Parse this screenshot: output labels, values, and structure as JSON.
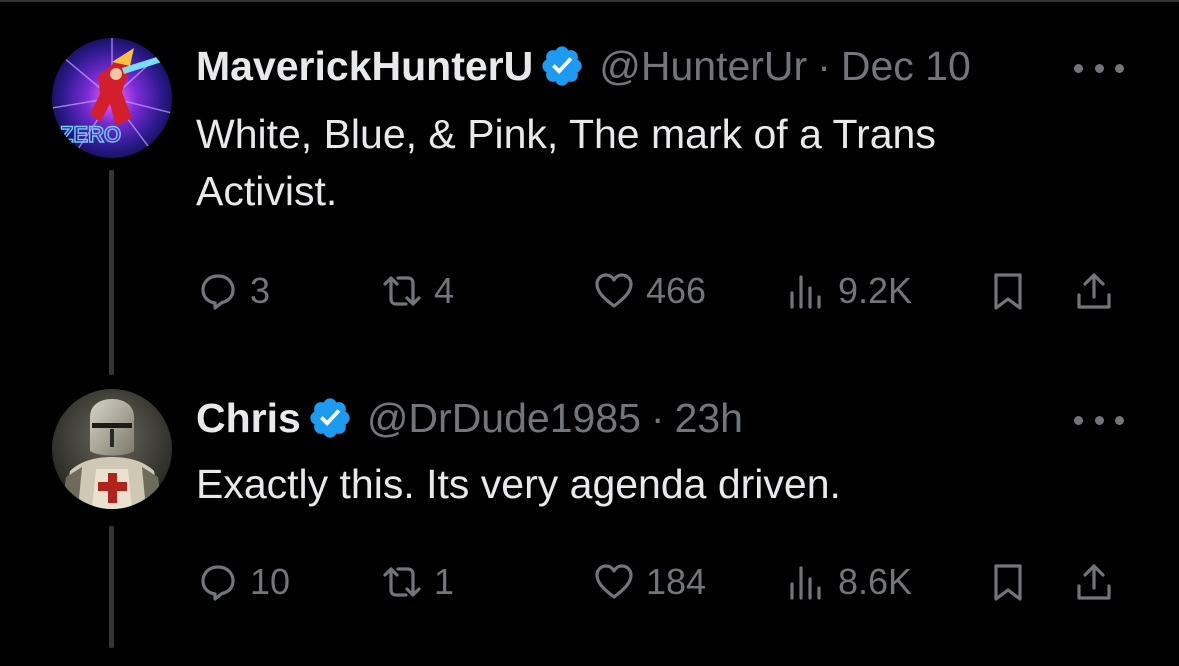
{
  "tweets": [
    {
      "display_name": "MaverickHunterU",
      "handle": "@HunterUr",
      "separator": "·",
      "timestamp": "Dec 10",
      "text_lines": [
        "White, Blue, & Pink, The mark of a Trans",
        "Activist."
      ],
      "avatar_text": "ZERO",
      "counts": {
        "replies": "3",
        "retweets": "4",
        "likes": "466",
        "views": "9.2K"
      },
      "verified": true
    },
    {
      "display_name": "Chris",
      "handle": "@DrDude1985",
      "separator": "·",
      "timestamp": "23h",
      "text_lines": [
        "Exactly this. Its very agenda driven."
      ],
      "counts": {
        "replies": "10",
        "retweets": "1",
        "likes": "184",
        "views": "8.6K"
      },
      "verified": true
    }
  ],
  "icons": {
    "verified": "verified-badge-icon",
    "more": "more-horizontal-icon",
    "reply": "reply-bubble-icon",
    "retweet": "retweet-icon",
    "like": "heart-icon",
    "views": "views-bar-chart-icon",
    "bookmark": "bookmark-icon",
    "share": "share-upload-icon"
  },
  "colors": {
    "background": "#000000",
    "text": "#e7e9ea",
    "muted": "#71767b",
    "verified": "#1d9bf0",
    "divider": "#2f3336"
  }
}
